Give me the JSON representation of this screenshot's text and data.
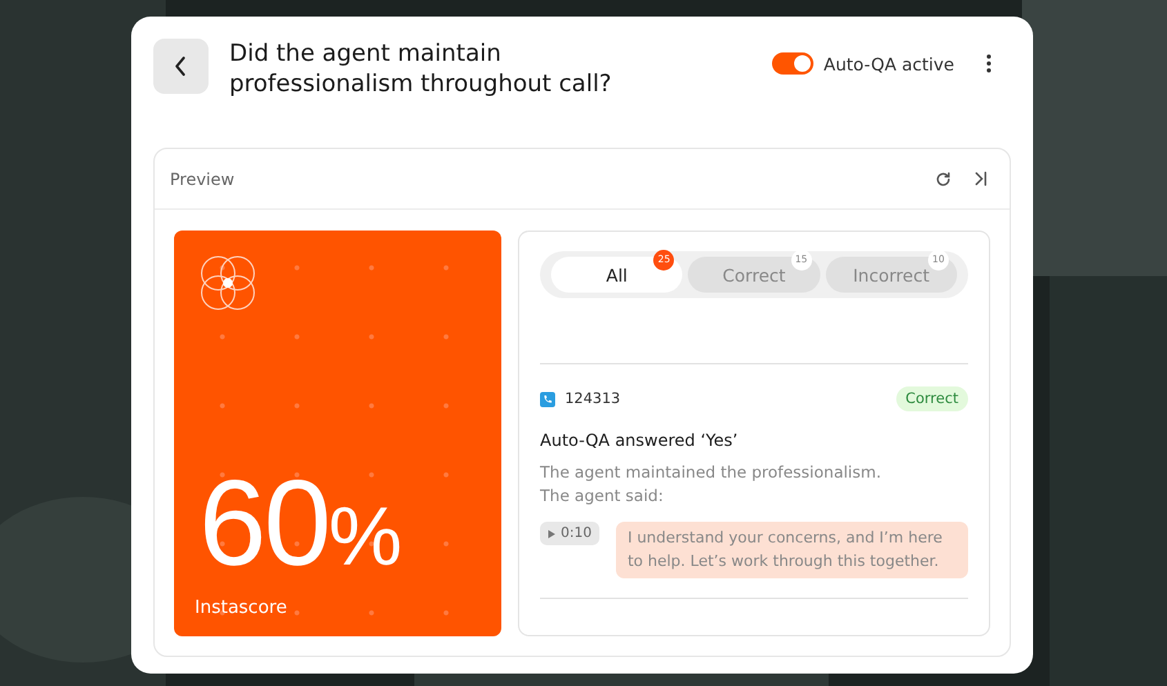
{
  "header": {
    "title": "Did the agent maintain professionalism throughout call?",
    "auto_qa": {
      "label": "Auto-QA active",
      "on": true
    }
  },
  "preview": {
    "title": "Preview"
  },
  "score": {
    "value": "60",
    "unit": "%",
    "label": "Instascore"
  },
  "filters": [
    {
      "label": "All",
      "count": "25",
      "selected": true
    },
    {
      "label": "Correct",
      "count": "15",
      "selected": false
    },
    {
      "label": "Incorrect",
      "count": "10",
      "selected": false
    }
  ],
  "result": {
    "call_id": "124313",
    "status": {
      "label": "Correct",
      "kind": "correct"
    },
    "heading": "Auto-QA answered ‘Yes’",
    "text": "The agent maintained the professionalism.",
    "said_label": "The agent said:",
    "timestamp": "0:10",
    "quote": "I understand your concerns, and I’m here to help. Let’s work through this together."
  }
}
